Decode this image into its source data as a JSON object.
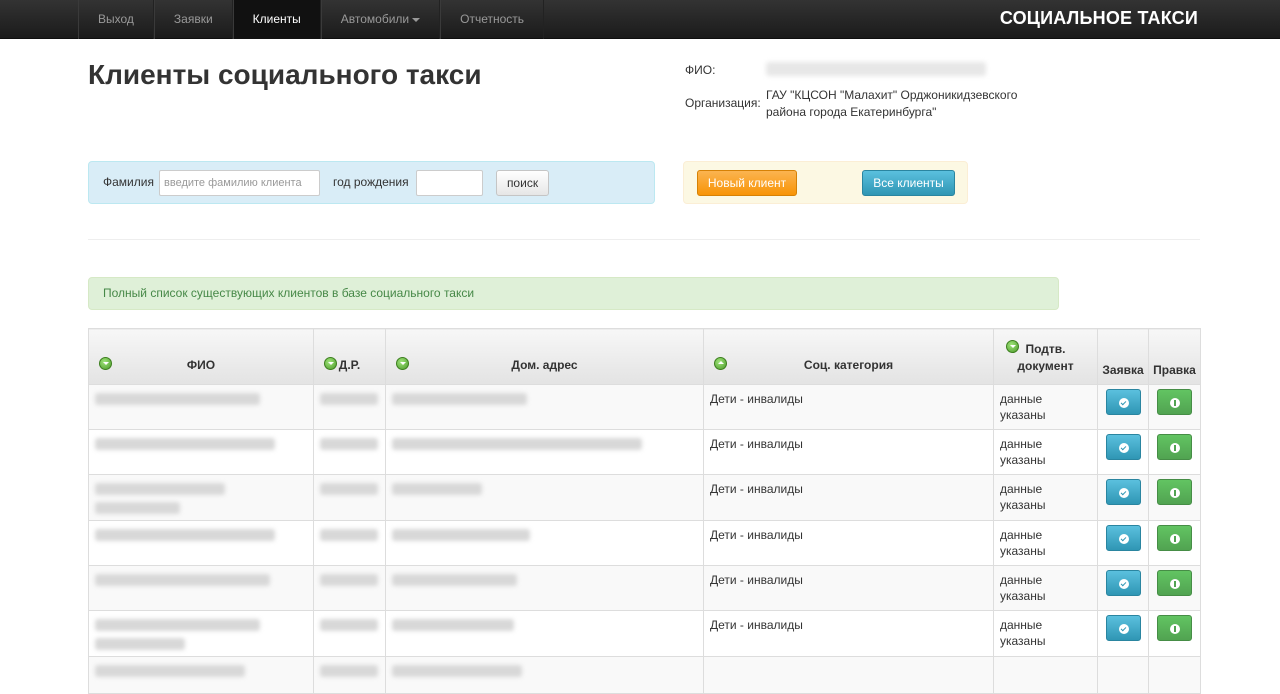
{
  "navbar": {
    "items": [
      {
        "label": "Выход",
        "active": false
      },
      {
        "label": "Заявки",
        "active": false
      },
      {
        "label": "Клиенты",
        "active": true
      },
      {
        "label": "Автомобили",
        "active": false,
        "dropdown": true
      },
      {
        "label": "Отчетность",
        "active": false
      }
    ],
    "brand": "СОЦИАЛЬНОЕ ТАКСИ"
  },
  "page_title": "Клиенты социального такси",
  "user": {
    "fio_label": "ФИО:",
    "org_label": "Организация:",
    "org_value": "ГАУ \"КЦСОН \"Малахит\" Орджоникидзевского района города Екатеринбурга\""
  },
  "search": {
    "surname_label": "Фамилия",
    "surname_placeholder": "введите фамилию клиента",
    "birth_label": "год рождения",
    "button": "поиск"
  },
  "actions": {
    "new_client": "Новый клиент",
    "all_clients": "Все клиенты"
  },
  "alert": "Полный список существующих клиентов в базе социального такси",
  "table": {
    "headers": {
      "fio": "ФИО",
      "dob": "Д.Р.",
      "address": "Дом. адрес",
      "category": "Соц. категория",
      "doc": "Подтв. документ",
      "request": "Заявка",
      "edit": "Правка"
    },
    "rows": [
      {
        "category": "Дети - инвалиды",
        "doc": "данные указаны"
      },
      {
        "category": "Дети - инвалиды",
        "doc": "данные указаны"
      },
      {
        "category": "Дети - инвалиды",
        "doc": "данные указаны"
      },
      {
        "category": "Дети - инвалиды",
        "doc": "данные указаны"
      },
      {
        "category": "Дети - инвалиды",
        "doc": "данные указаны"
      },
      {
        "category": "Дети - инвалиды",
        "doc": "данные указаны"
      }
    ]
  },
  "icons": {
    "sort": "sort-circle-icon",
    "request": "check-circle-icon",
    "edit": "info-circle-icon"
  },
  "colors": {
    "navbar": "#222222",
    "search_panel": "#d9edf7",
    "action_panel": "#fcf8e3",
    "alert_bg": "#dff0d8",
    "alert_text": "#468847",
    "warning_button": "#f89406",
    "info_button": "#2f96b4",
    "success_button": "#51a351"
  }
}
